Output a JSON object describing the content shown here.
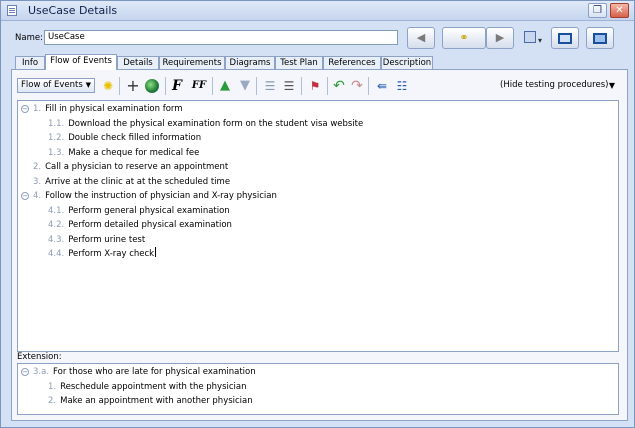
{
  "window": {
    "title": "UseCase Details",
    "restore_glyph": "❐",
    "close_glyph": "✕"
  },
  "name_field": {
    "label": "Name:",
    "value": "UseCase"
  },
  "header_buttons": {
    "back": "◀",
    "forward": "▶",
    "link": "⚭",
    "extra_caret": "▾"
  },
  "tabs": [
    {
      "label": "Info"
    },
    {
      "label": "Flow of Events"
    },
    {
      "label": "Details"
    },
    {
      "label": "Requirements"
    },
    {
      "label": "Diagrams"
    },
    {
      "label": "Test Plan"
    },
    {
      "label": "References"
    },
    {
      "label": "Description"
    }
  ],
  "active_tab": "Flow of Events",
  "toolbar": {
    "flow_select": "Flow of Events",
    "hide_select": "(Hide testing procedures)",
    "icons": [
      "sparkle-icon",
      "add-step-icon",
      "globe-icon",
      "font-icon",
      "font-size-icon",
      "move-up-icon",
      "move-down-icon",
      "outdent-icon",
      "indent-icon",
      "flag-icon",
      "undo-icon",
      "redo-icon",
      "split-icon",
      "checklist-icon"
    ]
  },
  "steps": [
    {
      "num": "1.",
      "text": "Fill in physical examination form",
      "level": 0,
      "toggle": "−"
    },
    {
      "num": "1.1.",
      "text": "Download the physical examination form on the student visa website",
      "level": 1
    },
    {
      "num": "1.2.",
      "text": "Double check filled information",
      "level": 1
    },
    {
      "num": "1.3.",
      "text": "Make a cheque for medical fee",
      "level": 1
    },
    {
      "num": "2.",
      "text": "Call a physician to reserve an appointment",
      "level": 0
    },
    {
      "num": "3.",
      "text": "Arrive at the clinic at at the scheduled time",
      "level": 0
    },
    {
      "num": "4.",
      "text": "Follow the instruction of physician and X-ray physician",
      "level": 0,
      "toggle": "−"
    },
    {
      "num": "4.1.",
      "text": "Perform general physical examination",
      "level": 1
    },
    {
      "num": "4.2.",
      "text": "Perform detailed physical examination",
      "level": 1
    },
    {
      "num": "4.3.",
      "text": "Perform urine test",
      "level": 1
    },
    {
      "num": "4.4.",
      "text": "Perform X-ray check",
      "level": 1
    }
  ],
  "extension": {
    "label": "Extension:",
    "items": [
      {
        "num": "3.a.",
        "text": "For those who are late for physical examination",
        "level": 0,
        "toggle": "−"
      },
      {
        "num": "1.",
        "text": "Reschedule appointment with the physician",
        "level": 1
      },
      {
        "num": "2.",
        "text": "Make an appointment with another physician",
        "level": 1
      }
    ]
  }
}
